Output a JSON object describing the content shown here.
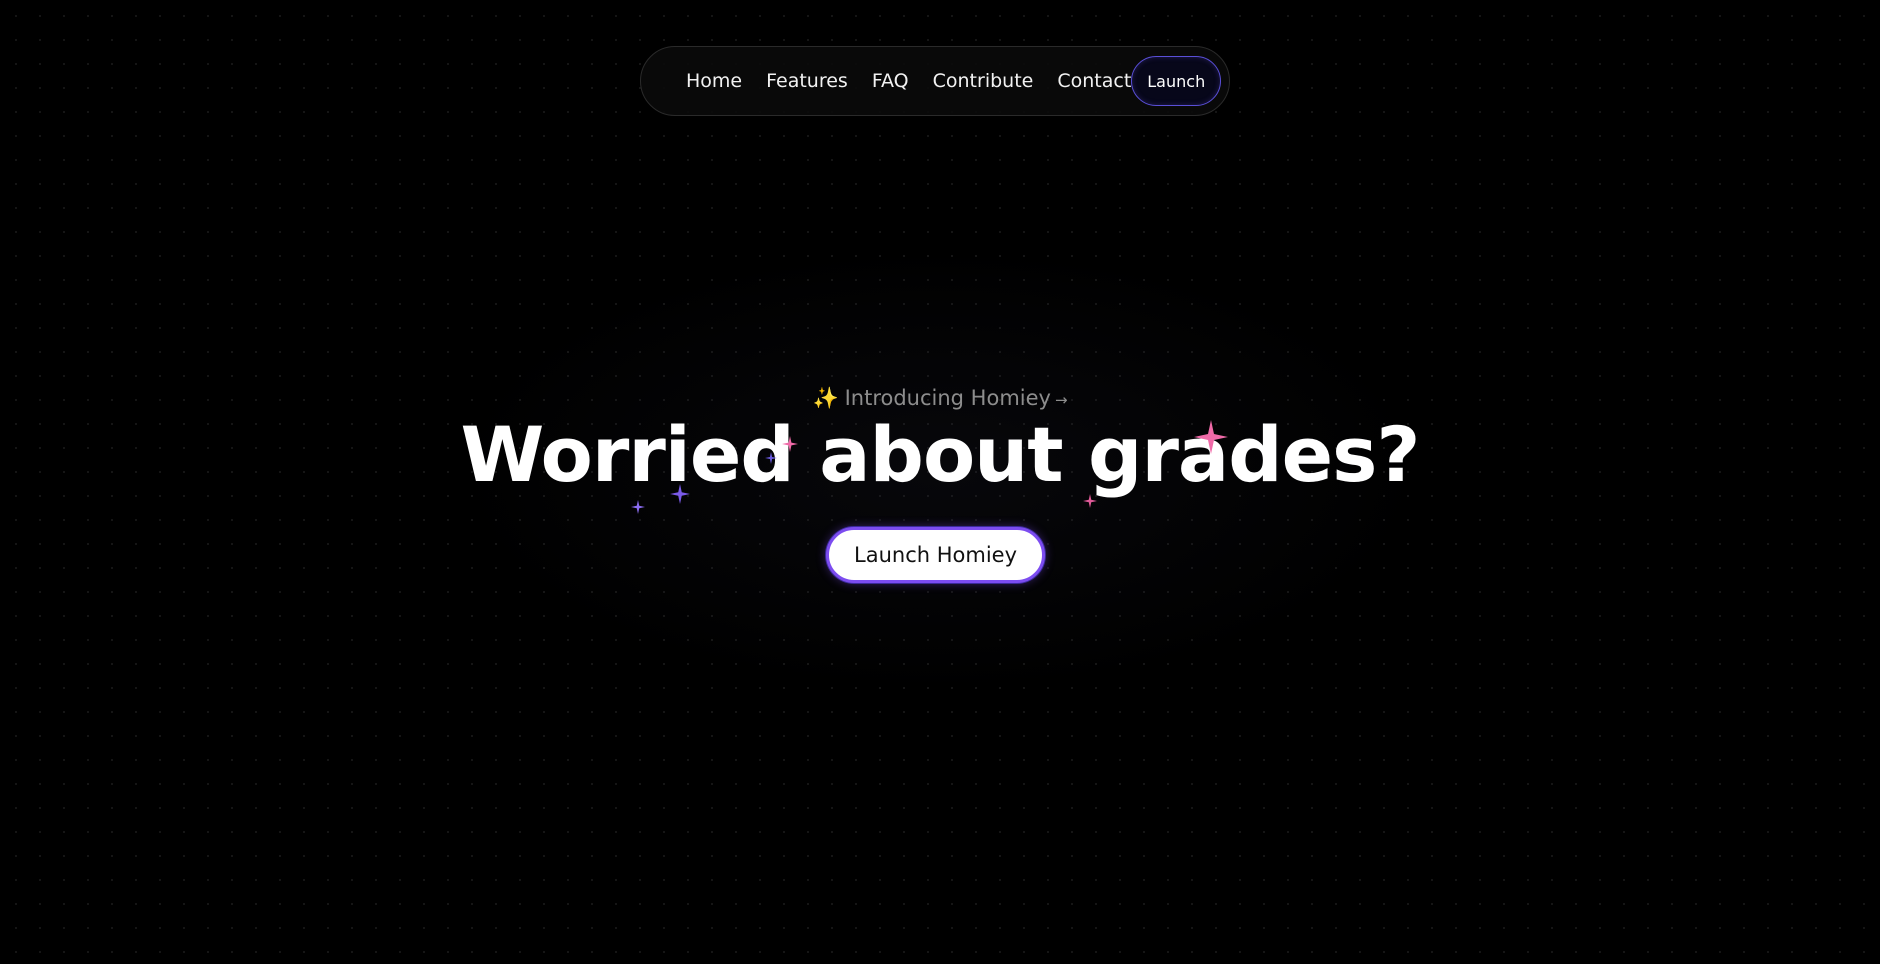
{
  "nav": {
    "links": [
      {
        "label": "Home"
      },
      {
        "label": "Features"
      },
      {
        "label": "FAQ"
      },
      {
        "label": "Contribute"
      },
      {
        "label": "Contact"
      }
    ],
    "launch_label": "Launch"
  },
  "hero": {
    "intro_text": "Introducing Homiey",
    "intro_icon": "sparkles-icon",
    "intro_arrow": "→",
    "headline": "Worried about grades?",
    "cta_label": "Launch Homiey"
  },
  "colors": {
    "background": "#000000",
    "accent_purple": "#7c4cf0",
    "sparkle_pink": "#f06aa8",
    "sparkle_violet": "#8a6cf0",
    "intro_text": "#8d8d8d"
  }
}
